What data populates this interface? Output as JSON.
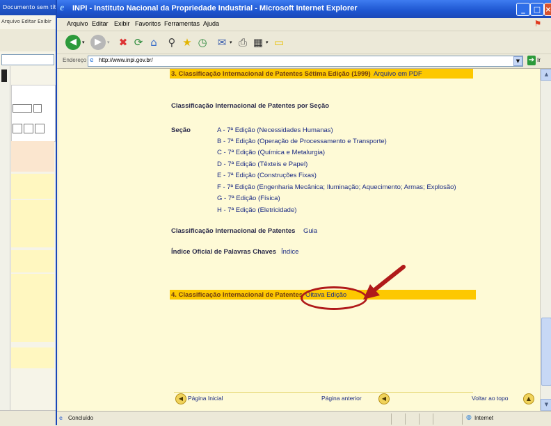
{
  "window": {
    "title": "INPI - Instituto Nacional da Propriedade Industrial - Microsoft Internet Explorer"
  },
  "menu": [
    "Arquivo",
    "Editar",
    "Exibir",
    "Favoritos",
    "Ferramentas",
    "Ajuda"
  ],
  "address": {
    "label": "Endereço",
    "url": "http://www.inpi.gov.br/",
    "go_label": "Ir"
  },
  "content": {
    "section3_title": "3. Classificação Internacional de Patentes Sétima Edição (1999)",
    "section3_link": "Arquivo em PDF",
    "by_section_heading": "Classificação Internacional de Patentes por Seção",
    "secao_label": "Seção",
    "sections": [
      "A - 7ª Edição (Necessidades Humanas)",
      "B - 7ª Edição (Operação de Processamento e Transporte)",
      "C - 7ª Edição (Química e Metalurgia)",
      "D - 7ª Edição (Têxteis e Papel)",
      "E - 7ª Edição (Construções Fixas)",
      "F - 7ª Edição (Engenharia Mecânica; Iluminação; Aquecimento; Armas; Explosão)",
      "G - 7ª Edição (Física)",
      "H - 7ª Edição (Eletricidade)"
    ],
    "guide_label": "Classificação Internacional de Patentes",
    "guide_link": "Guia",
    "keywords_label": "Índice Oficial de Palavras Chaves",
    "keywords_link": "Índice",
    "section4_title": "4. Classificação Internacional de Patentes",
    "section4_link": "Oitava Edição"
  },
  "bottom_nav": {
    "home": "Página Inicial",
    "previous": "Página anterior",
    "top": "Voltar ao topo"
  },
  "status": {
    "text": "Concluído",
    "zone": "Internet"
  },
  "background_window": {
    "title": "Documento sem título",
    "menu": "Arquivo  Editar  Exibir"
  }
}
